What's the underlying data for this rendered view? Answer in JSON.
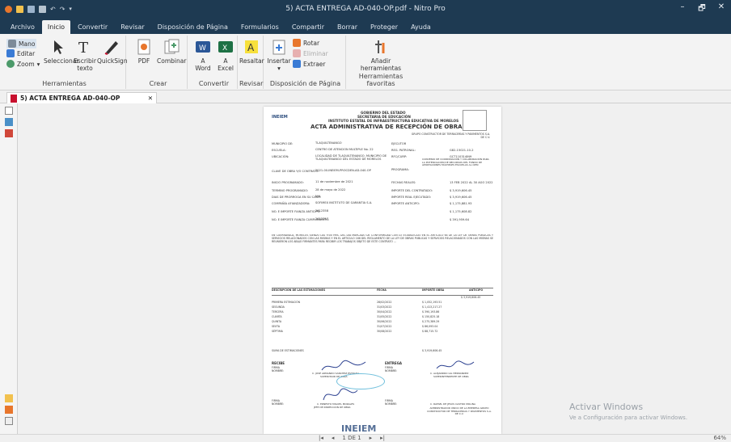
{
  "window": {
    "title": "5) ACTA ENTREGA AD-040-OP.pdf - Nitro Pro",
    "controls": [
      "–",
      "🗗",
      "✕"
    ]
  },
  "menu_tabs": [
    "Archivo",
    "Inicio",
    "Convertir",
    "Revisar",
    "Disposición de Página",
    "Formularios",
    "Compartir",
    "Borrar",
    "Proteger",
    "Ayuda"
  ],
  "ribbon": {
    "herramientas": {
      "mano": "Mano",
      "editar": "Editar",
      "zoom": "Zoom",
      "seleccionar": "Seleccionar",
      "escribir": "Escribir texto",
      "quicksign": "QuickSign",
      "label": "Herramientas"
    },
    "crear": {
      "pdf": "PDF",
      "combinar": "Combinar",
      "label": "Crear"
    },
    "convertir": {
      "word_a": "A",
      "word": "Word",
      "excel_a": "A",
      "excel": "Excel",
      "label": "Convertir"
    },
    "revisar": {
      "resaltar": "Resaltar",
      "label": "Revisar"
    },
    "disposicion": {
      "insertar": "Insertar",
      "rotar": "Rotar",
      "eliminar": "Eliminar",
      "extraer": "Extraer",
      "label": "Disposición de Página"
    },
    "favoritas": {
      "anadir": "Añadir herramientas",
      "label": "Herramientas favoritas"
    }
  },
  "doc_tab": {
    "label": "5) ACTA ENTREGA AD-040-OP",
    "close": "✕"
  },
  "document": {
    "h1": "GOBIERNO DEL ESTADO",
    "h2": "SECRETARIA DE EDUCACIÓN",
    "h3": "INSTITUTO ESTATAL DE INFRAESTRUCTURA EDUCATIVA DE MORELOS",
    "title": "ACTA  ADMINISTRATIVA DE RECEPCIÓN DE OBRA",
    "logo": "INEIEM",
    "contractor": "GRUPO CONSTRUCTOR DE TERRACERÍAS Y PAVIMENTOS S.A. DE C.V.",
    "fields": [
      {
        "label": "MUNICIPIO DE:",
        "value": "TLAQUILTENANGO"
      },
      {
        "label": "ESCUELA:",
        "value": "CENTRO DE ATENCION MULTIPLE No. 22"
      },
      {
        "label": "UBICACIÓN:",
        "value": "LOCALIDAD DE TLAQUILTENANGO, MUNICIPIO DE TLAQUILTENANGO DEL ESTADO DE MORELOS"
      },
      {
        "label": "CLAVE DE OBRA Y/O CONTRATO:",
        "value": "2021-00-INEIEM-PROCDEN-AD-040-OP"
      },
      {
        "label": "INICIO PROGRAMADO:",
        "value": "11 de noviembre de 2021"
      },
      {
        "label": "TERMINO PROGRAMADO:",
        "value": "28 de mayo de 2022"
      },
      {
        "label": "DIAS DE PRORROGA EN SU CASO:",
        "value": "N/A"
      },
      {
        "label": "COMPAÑÍA AFIANZADORA:",
        "value": "SOFIMEX INSTITUTO DE GARANTIA S.A."
      },
      {
        "label": "NO. E IMPORTE FIANZA ANTICIPO:",
        "value": "2612358"
      },
      {
        "label": "NO. E IMPORTE FIANZA CUMPLIMIENTO:",
        "value": "2612357"
      }
    ],
    "right_fields": [
      {
        "label": "EJECUTOR",
        "value": ""
      },
      {
        "label": "REG. PATRONAL:",
        "value": "G82-15021-10-2"
      },
      {
        "label": "RFC/CURP:",
        "value": "GCT110314IN9"
      },
      {
        "label": "PROGRAMA:",
        "value": "CONVENIO DE COORDINACIÓN Y COLABORACIÓN PARA LA POTENCIACIÓN DE RECURSOS DEL FONDO DE APORTACIONES MÚLTIPLES ESCUELAS AL CIEN"
      },
      {
        "label": "FECHAS REALES:",
        "value": "13 FEB 2022 AL 30 AGO 2022"
      },
      {
        "label": "IMPORTE DEL CONTRATADO:",
        "value": "$    3,919,606.45"
      },
      {
        "label": "IMPORTE REAL EJECUTADO:",
        "value": "$    3,919,606.45"
      },
      {
        "label": "IMPORTE ANTICIPO:",
        "value": "$    1,175,881.93"
      },
      {
        "label": "",
        "value": "$    1,175,608.82"
      },
      {
        "label": "",
        "value": "$      391,959.64"
      }
    ],
    "paragraph": "EN CUERNAVACA, MORELOS SIENDO LAS 9:00 HRS. DEL DIA MARCADO DE CONFORMIDAD CON LO ESTABLECIDO EN EL ARTICULO 64 DE LA LEY DE OBRAS PUBLICAS Y SERVICIOS RELACIONADOS CON LAS MISMAS Y EN EL ARTICULO 166 DEL REGLAMENTO DE LA LEY DE OBRAS PUBLICAS Y SERVICIOS RELACIONADOS CON LAS MISMAS SE REUNIERON LOS ABAJO FIRMANTES PARA RECIBIR LOS TRABAJOS OBJETO DE ESTE CONTRATO ...",
    "table_headers": [
      "DESCRIPCIÓN DE LAS ESTIMACIONES",
      "FECHA",
      "IMPORTE OBRA",
      "ANTICIPO"
    ],
    "table_rows": [
      {
        "desc": "PRIMERA ESTIMACIÓN",
        "fecha": "28/02/2022",
        "importe": "$   1,052,193.51"
      },
      {
        "desc": "SEGUNDA",
        "fecha": "31/03/2022",
        "importe": "$   1,413,217.27"
      },
      {
        "desc": "TERCERA",
        "fecha": "30/04/2022",
        "importe": "$     390,193.86"
      },
      {
        "desc": "CUARTA",
        "fecha": "31/05/2022",
        "importe": "$     150,825.18"
      },
      {
        "desc": "QUINTA",
        "fecha": "30/06/2022",
        "importe": "$     275,389.29"
      },
      {
        "desc": "SEXTA",
        "fecha": "31/07/2022",
        "importe": "$       86,093.04"
      },
      {
        "desc": "SÉPTIMA",
        "fecha": "30/08/2022",
        "importe": "$       88,715.72"
      }
    ],
    "anticipo_total": "$   3,919,606.45",
    "suma": "SUMA DE ESTIMACIONES",
    "suma_importe": "$   3,919,606.45",
    "recibe": "RECIBE",
    "entrega": "ENTREGA",
    "firma": "FIRMA",
    "nombre": "NOMBRE:",
    "sign1": "C. JOSÉ ARMANDO SÁNCHEZ ESTRADA",
    "sign1_role": "SUPERVISOR DE OBRA",
    "sign2": "C. ALEJANDRO GIL HERNÁNDEZ",
    "sign2_role": "SUPERINTENDENTE DE OBRA",
    "sign3": "C. ERNESTO MIGUEL MORALES",
    "sign3_role": "JEFE DE INSPECCIÓN DE OBRA",
    "sign4": "C. RAFAEL DE JESÚS CASTRO MOLINA",
    "sign4_role": "ADMINISTRADOR ÚNICO DE LA EMPRESA GRUPO CONSTRUCTOR DE TERRACERIAS Y PAVIMENTOS S.A. DE C.V."
  },
  "watermark": {
    "line1": "Activar Windows",
    "line2": "Ve a Configuración para activar Windows."
  },
  "status": {
    "page": "1 DE 1",
    "zoom": "64%"
  },
  "colors": {
    "titlebar": "#1e3a52",
    "ribbon": "#f3f3f3",
    "accent_red": "#c8102e"
  }
}
